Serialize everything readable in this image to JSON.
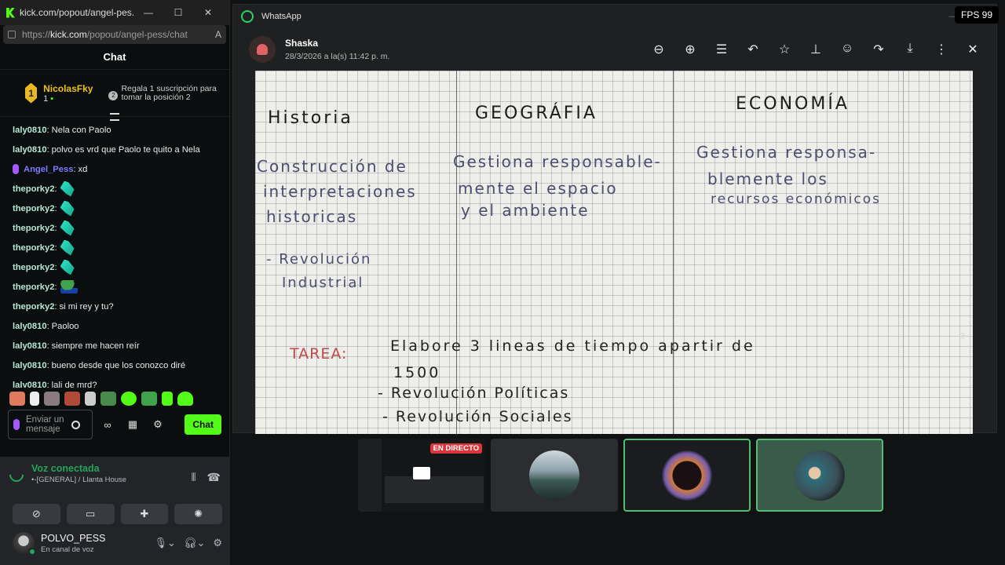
{
  "kick": {
    "window_title": "kick.com/popout/angel-pes...",
    "url_prefix": "https://",
    "url_host": "kick.com",
    "url_path": "/popout/angel-pess/chat",
    "chat_header": "Chat",
    "pinned": {
      "rank": "1",
      "user": "NicolasFky",
      "count": "1",
      "gift_icon": "2",
      "gift_text": "Regala 1 suscripción para tomar la posición 2"
    },
    "messages": [
      {
        "user": "laly0810",
        "text": "Nela con Paolo"
      },
      {
        "user": "laly0810",
        "text": "polvo es vrd que Paolo te quito a Nela"
      },
      {
        "user": "Angel_Pess",
        "text": "xd"
      },
      {
        "user": "theporky2",
        "text": ""
      },
      {
        "user": "theporky2",
        "text": ""
      },
      {
        "user": "theporky2",
        "text": ""
      },
      {
        "user": "theporky2",
        "text": ""
      },
      {
        "user": "theporky2",
        "text": ""
      },
      {
        "user": "theporky2",
        "text": ""
      },
      {
        "user": "theporky2",
        "text": "si mi rey y tu?"
      },
      {
        "user": "laly0810",
        "text": "Paoloo"
      },
      {
        "user": "laly0810",
        "text": "siempre me hacen reír"
      },
      {
        "user": "laly0810",
        "text": "bueno desde que los conozco diré"
      },
      {
        "user": "laly0810",
        "text": "lali de mrd?"
      }
    ],
    "input_placeholder": "Enviar un mensaje",
    "send_label": "Chat"
  },
  "discord": {
    "voice_status": "Voz conectada",
    "voice_channel": "•-[GENERAL] / Llanta House",
    "username": "POLVO_PESS",
    "user_status": "En canal de voz"
  },
  "whatsapp": {
    "app_title": "WhatsApp",
    "contact": "Shaska",
    "timestamp": "28/3/2026 a la(s) 11:42 p. m.",
    "icons": [
      "zoom-out-icon",
      "zoom-in-icon",
      "caption-icon",
      "reply-icon",
      "star-icon",
      "pin-icon",
      "emoji-icon",
      "forward-icon",
      "download-icon",
      "more-icon",
      "close-icon"
    ]
  },
  "photo_text": {
    "h1": "Historia",
    "h2": "GEOGRÁFIA",
    "h3": "ECONOMÍA",
    "c1a": "Construcción de",
    "c1b": "interpretaciones",
    "c1c": "historicas",
    "c2a": "Gestiona responsable-",
    "c2b": "mente el espacio",
    "c2c": "y el ambiente",
    "c3a": "Gestiona responsa-",
    "c3b": "blemente los",
    "c3c": "recursos económicos",
    "l1": "- Revolución",
    "l2": "Industrial",
    "tarea": "TAREA:",
    "t1": "Elabore 3 lineas de tiempo apartir de",
    "t2": "1500",
    "t3": "- Revolución   Políticas",
    "t4": "- Revolución   Sociales"
  },
  "stream": {
    "live_badge": "EN DIRECTO"
  },
  "fps": "FPS 99"
}
